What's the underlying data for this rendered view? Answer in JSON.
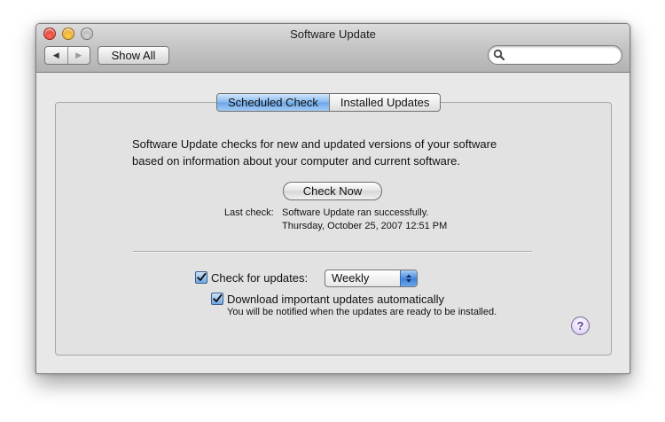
{
  "window": {
    "title": "Software Update"
  },
  "toolbar": {
    "back_glyph": "◀",
    "forward_glyph": "▶",
    "show_all_label": "Show All",
    "search_value": "",
    "search_placeholder": ""
  },
  "tabs": [
    {
      "label": "Scheduled Check",
      "selected": true
    },
    {
      "label": "Installed Updates",
      "selected": false
    }
  ],
  "content": {
    "description_line1": "Software Update checks for new and updated versions of your software",
    "description_line2": "based on information about your computer and current software.",
    "check_now_label": "Check Now",
    "last_check_label": "Last check:",
    "last_check_status": "Software Update ran successfully.",
    "last_check_date": "Thursday, October 25, 2007 12:51 PM",
    "check_for_updates_label": "Check for updates:",
    "check_for_updates_checked": true,
    "frequency_selected": "Weekly",
    "download_label": "Download important updates automatically",
    "download_checked": true,
    "download_note": "You will be notified when the updates are ready to be installed.",
    "help_glyph": "?"
  },
  "colors": {
    "selected_tab": "#86b8ee",
    "checkbox": "#6fa5e3",
    "close_light": "#ff5f57",
    "minimize_light": "#ffbd2e",
    "help_accent": "#5a3c99"
  },
  "icons": [
    "close-light",
    "minimize-light",
    "zoom-light",
    "back-arrow-icon",
    "forward-arrow-icon",
    "search-icon",
    "checkmark-icon",
    "popup-arrows-icon",
    "help-icon"
  ]
}
